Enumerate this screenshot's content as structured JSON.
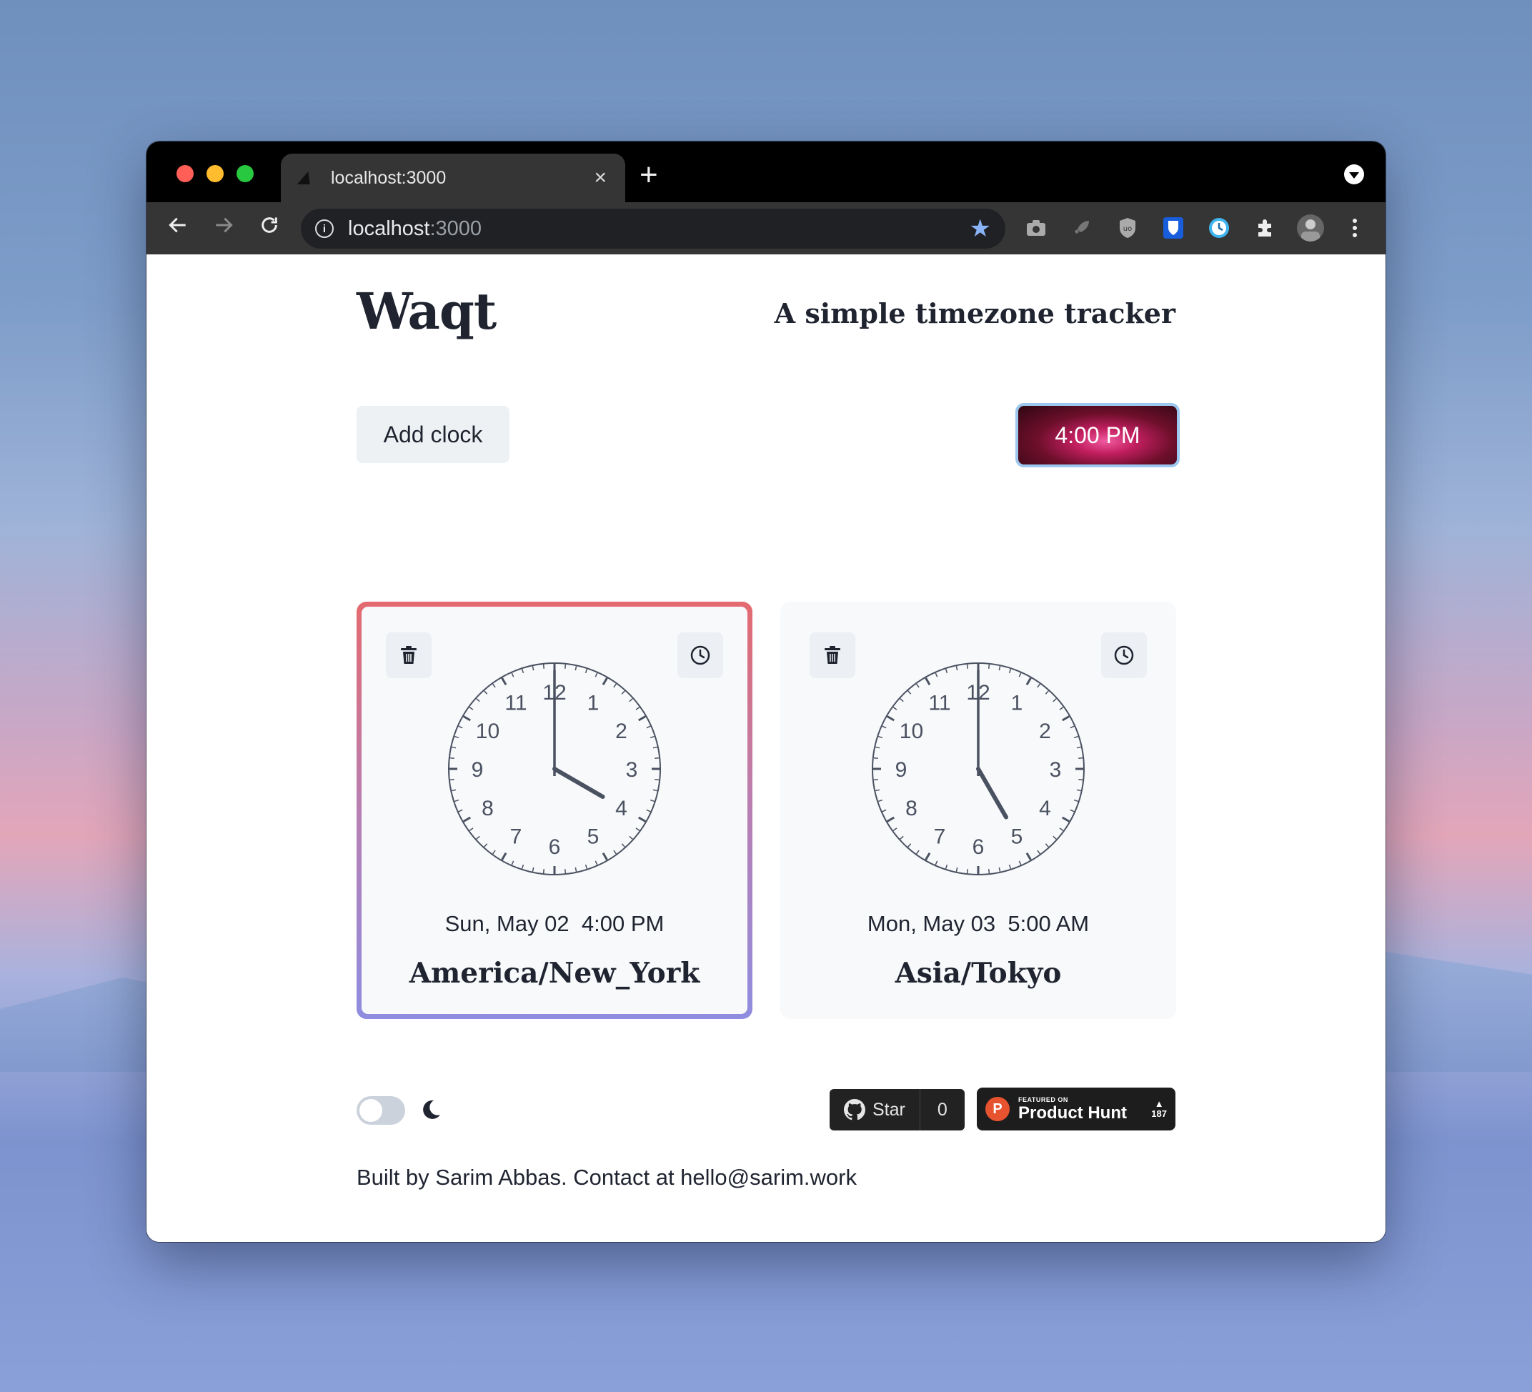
{
  "browser": {
    "tab_title": "localhost:3000",
    "tab_close": "×",
    "new_tab": "+",
    "url_host": "localhost",
    "url_port": ":3000"
  },
  "app": {
    "logo": "Waqt",
    "tagline": "A simple timezone tracker",
    "add_clock_label": "Add clock",
    "current_time": "4:00 PM"
  },
  "clocks": [
    {
      "date": "Sun, May 02",
      "time": "4:00 PM",
      "timezone": "America/New_York",
      "hour": 4,
      "minute": 0,
      "active": true
    },
    {
      "date": "Mon, May 03",
      "time": "5:00 AM",
      "timezone": "Asia/Tokyo",
      "hour": 5,
      "minute": 0,
      "active": false
    }
  ],
  "clock_face_numbers": [
    "12",
    "1",
    "2",
    "3",
    "4",
    "5",
    "6",
    "7",
    "8",
    "9",
    "10",
    "11"
  ],
  "footer": {
    "github_star": "Star",
    "github_count": "0",
    "ph_featured": "FEATURED ON",
    "ph_name": "Product Hunt",
    "ph_votes": "187",
    "credit": "Built by Sarim Abbas. Contact at hello@sarim.work"
  },
  "colors": {
    "active_border_top": "#e46a70",
    "active_border_bottom": "#8f8de0",
    "clock_stroke": "#4a5160"
  }
}
